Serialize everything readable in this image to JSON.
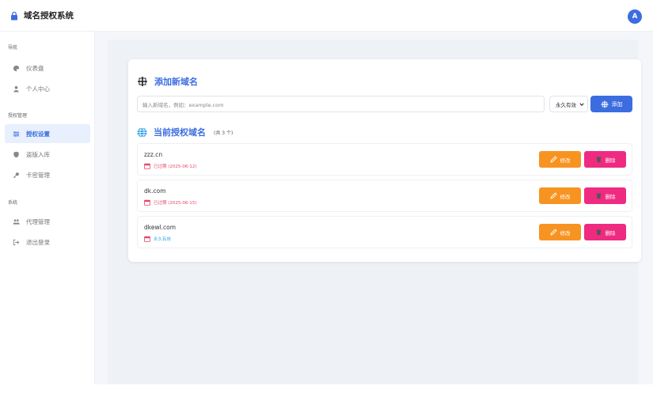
{
  "header": {
    "title": "域名授权系统",
    "avatar_letter": "A"
  },
  "sidebar": {
    "groups": [
      {
        "title": "导航",
        "items": [
          {
            "label": "仪表盘",
            "icon": "palette-icon"
          },
          {
            "label": "个人中心",
            "icon": "user-icon"
          }
        ]
      },
      {
        "title": "授权管理",
        "items": [
          {
            "label": "授权设置",
            "icon": "sliders-icon",
            "active": true
          },
          {
            "label": "盗版入库",
            "icon": "shield-icon"
          },
          {
            "label": "卡密管理",
            "icon": "key-icon"
          }
        ]
      },
      {
        "title": "系统",
        "items": [
          {
            "label": "代理管理",
            "icon": "users-icon"
          },
          {
            "label": "退出登录",
            "icon": "logout-icon"
          }
        ]
      }
    ]
  },
  "add_section": {
    "title": "添加新域名",
    "input_placeholder": "输入新域名，例如：example.com",
    "select_value": "永久有效",
    "add_button": "添加"
  },
  "list_section": {
    "title": "当前授权域名",
    "count_text": "(共 3 个)",
    "edit_label": "修改",
    "delete_label": "删除",
    "domains": [
      {
        "name": "zzz.cn",
        "status": "已过期 (2025-06-12)",
        "status_type": "expired"
      },
      {
        "name": "dk.com",
        "status": "已过期 (2025-06-15)",
        "status_type": "expired"
      },
      {
        "name": "dkewl.com",
        "status": "永久有效",
        "status_type": "forever"
      }
    ]
  },
  "colors": {
    "accent": "#3b6de0",
    "edit": "#f79421",
    "delete": "#ef2b81",
    "expired": "#e8466b",
    "forever": "#3ba7e6"
  }
}
